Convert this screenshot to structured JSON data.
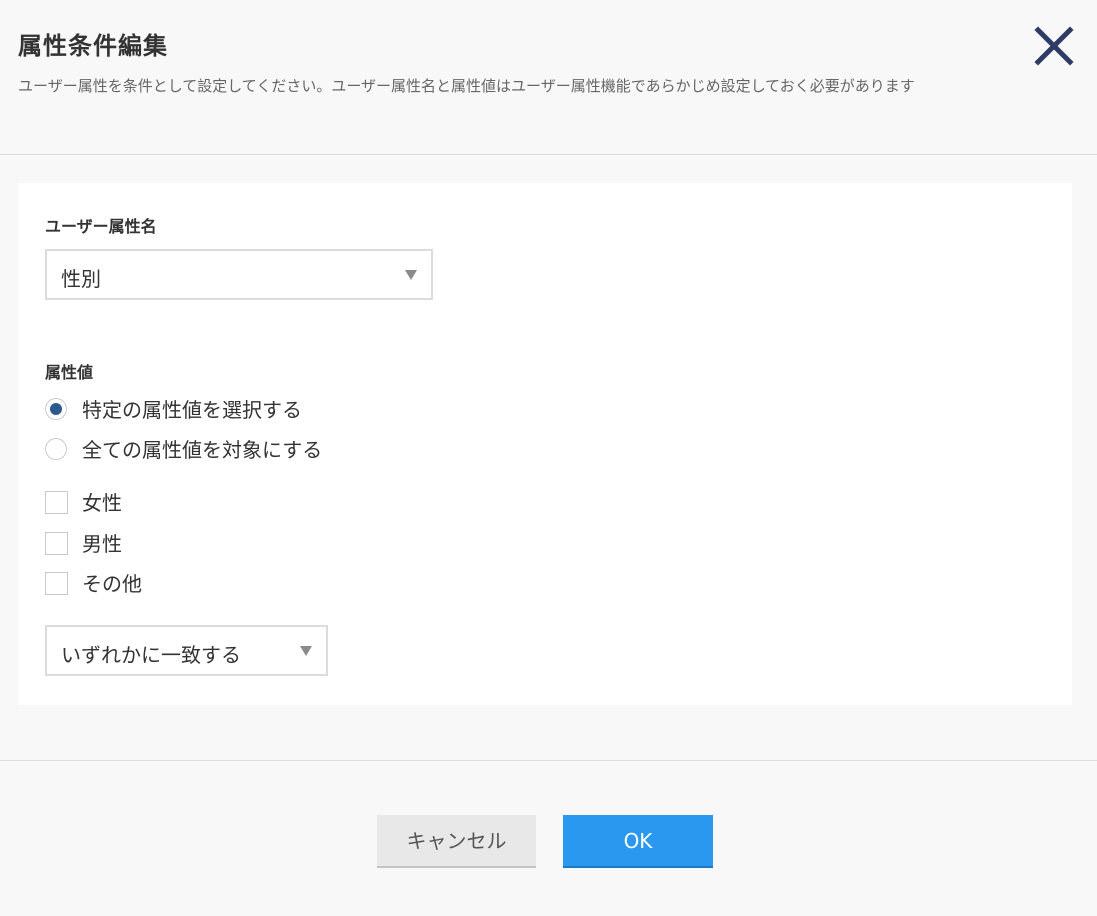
{
  "dialog": {
    "title": "属性条件編集",
    "description": "ユーザー属性を条件として設定してください。ユーザー属性名と属性値はユーザー属性機能であらかじめ設定しておく必要があります"
  },
  "form": {
    "attribute_name_label": "ユーザー属性名",
    "attribute_name_value": "性別",
    "attribute_value_label": "属性値",
    "radio_options": [
      {
        "label": "特定の属性値を選択する",
        "selected": true
      },
      {
        "label": "全ての属性値を対象にする",
        "selected": false
      }
    ],
    "checkbox_options": [
      {
        "label": "女性",
        "checked": false
      },
      {
        "label": "男性",
        "checked": false
      },
      {
        "label": "その他",
        "checked": false
      }
    ],
    "match_mode_value": "いずれかに一致する"
  },
  "footer": {
    "cancel_label": "キャンセル",
    "ok_label": "OK"
  },
  "colors": {
    "close_icon": "#2d3b66",
    "radio_selected": "#2d5a8c",
    "ok_button": "#2b98f0",
    "cancel_button": "#e8e8e8"
  }
}
